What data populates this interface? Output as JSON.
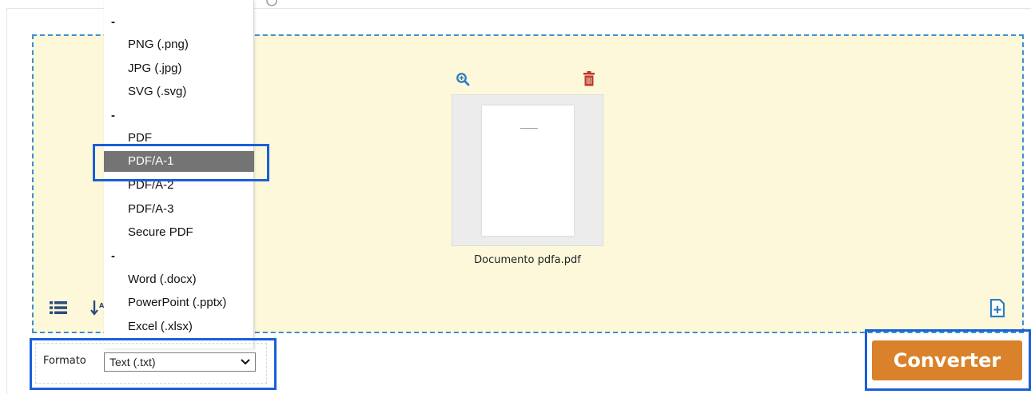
{
  "format_menu": {
    "options": [
      {
        "label": "-",
        "separator": true
      },
      {
        "label": "PNG (.png)"
      },
      {
        "label": "JPG (.jpg)"
      },
      {
        "label": "SVG (.svg)"
      },
      {
        "label": "-",
        "separator": true
      },
      {
        "label": "PDF"
      },
      {
        "label": "PDF/A-1",
        "selected": true
      },
      {
        "label": "PDF/A-2"
      },
      {
        "label": "PDF/A-3"
      },
      {
        "label": "Secure PDF"
      },
      {
        "label": "-",
        "separator": true
      },
      {
        "label": "Word (.docx)"
      },
      {
        "label": "PowerPoint (.pptx)"
      },
      {
        "label": "Excel (.xlsx)"
      }
    ],
    "selected_color": "#747474"
  },
  "file": {
    "name": "Documento pdfa.pdf"
  },
  "toolbar": {
    "icons": [
      "zoom-in-icon",
      "trash-icon",
      "list-view-icon",
      "sort-icon",
      "add-file-icon"
    ]
  },
  "format": {
    "label": "Formato",
    "value": "Text (.txt)"
  },
  "convert": {
    "label": "Converter",
    "color": "#d9822b"
  },
  "highlight_color": "#1a5fd8",
  "dropzone_color": "#fdf8da"
}
